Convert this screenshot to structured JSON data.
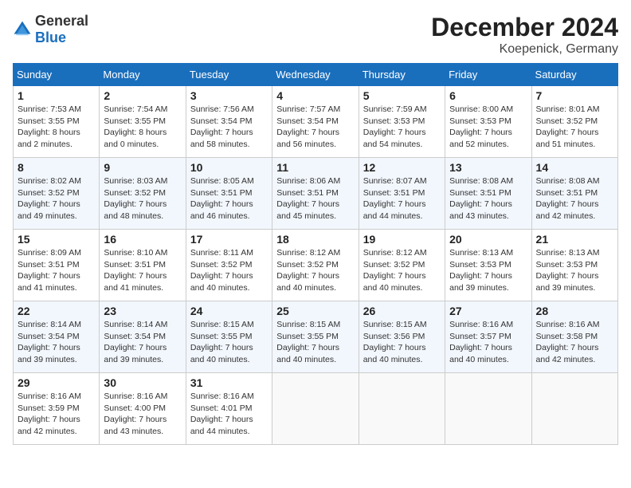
{
  "header": {
    "logo_general": "General",
    "logo_blue": "Blue",
    "month_title": "December 2024",
    "location": "Koepenick, Germany"
  },
  "weekdays": [
    "Sunday",
    "Monday",
    "Tuesday",
    "Wednesday",
    "Thursday",
    "Friday",
    "Saturday"
  ],
  "weeks": [
    [
      {
        "day": "1",
        "sunrise": "Sunrise: 7:53 AM",
        "sunset": "Sunset: 3:55 PM",
        "daylight": "Daylight: 8 hours and 2 minutes."
      },
      {
        "day": "2",
        "sunrise": "Sunrise: 7:54 AM",
        "sunset": "Sunset: 3:55 PM",
        "daylight": "Daylight: 8 hours and 0 minutes."
      },
      {
        "day": "3",
        "sunrise": "Sunrise: 7:56 AM",
        "sunset": "Sunset: 3:54 PM",
        "daylight": "Daylight: 7 hours and 58 minutes."
      },
      {
        "day": "4",
        "sunrise": "Sunrise: 7:57 AM",
        "sunset": "Sunset: 3:54 PM",
        "daylight": "Daylight: 7 hours and 56 minutes."
      },
      {
        "day": "5",
        "sunrise": "Sunrise: 7:59 AM",
        "sunset": "Sunset: 3:53 PM",
        "daylight": "Daylight: 7 hours and 54 minutes."
      },
      {
        "day": "6",
        "sunrise": "Sunrise: 8:00 AM",
        "sunset": "Sunset: 3:53 PM",
        "daylight": "Daylight: 7 hours and 52 minutes."
      },
      {
        "day": "7",
        "sunrise": "Sunrise: 8:01 AM",
        "sunset": "Sunset: 3:52 PM",
        "daylight": "Daylight: 7 hours and 51 minutes."
      }
    ],
    [
      {
        "day": "8",
        "sunrise": "Sunrise: 8:02 AM",
        "sunset": "Sunset: 3:52 PM",
        "daylight": "Daylight: 7 hours and 49 minutes."
      },
      {
        "day": "9",
        "sunrise": "Sunrise: 8:03 AM",
        "sunset": "Sunset: 3:52 PM",
        "daylight": "Daylight: 7 hours and 48 minutes."
      },
      {
        "day": "10",
        "sunrise": "Sunrise: 8:05 AM",
        "sunset": "Sunset: 3:51 PM",
        "daylight": "Daylight: 7 hours and 46 minutes."
      },
      {
        "day": "11",
        "sunrise": "Sunrise: 8:06 AM",
        "sunset": "Sunset: 3:51 PM",
        "daylight": "Daylight: 7 hours and 45 minutes."
      },
      {
        "day": "12",
        "sunrise": "Sunrise: 8:07 AM",
        "sunset": "Sunset: 3:51 PM",
        "daylight": "Daylight: 7 hours and 44 minutes."
      },
      {
        "day": "13",
        "sunrise": "Sunrise: 8:08 AM",
        "sunset": "Sunset: 3:51 PM",
        "daylight": "Daylight: 7 hours and 43 minutes."
      },
      {
        "day": "14",
        "sunrise": "Sunrise: 8:08 AM",
        "sunset": "Sunset: 3:51 PM",
        "daylight": "Daylight: 7 hours and 42 minutes."
      }
    ],
    [
      {
        "day": "15",
        "sunrise": "Sunrise: 8:09 AM",
        "sunset": "Sunset: 3:51 PM",
        "daylight": "Daylight: 7 hours and 41 minutes."
      },
      {
        "day": "16",
        "sunrise": "Sunrise: 8:10 AM",
        "sunset": "Sunset: 3:51 PM",
        "daylight": "Daylight: 7 hours and 41 minutes."
      },
      {
        "day": "17",
        "sunrise": "Sunrise: 8:11 AM",
        "sunset": "Sunset: 3:52 PM",
        "daylight": "Daylight: 7 hours and 40 minutes."
      },
      {
        "day": "18",
        "sunrise": "Sunrise: 8:12 AM",
        "sunset": "Sunset: 3:52 PM",
        "daylight": "Daylight: 7 hours and 40 minutes."
      },
      {
        "day": "19",
        "sunrise": "Sunrise: 8:12 AM",
        "sunset": "Sunset: 3:52 PM",
        "daylight": "Daylight: 7 hours and 40 minutes."
      },
      {
        "day": "20",
        "sunrise": "Sunrise: 8:13 AM",
        "sunset": "Sunset: 3:53 PM",
        "daylight": "Daylight: 7 hours and 39 minutes."
      },
      {
        "day": "21",
        "sunrise": "Sunrise: 8:13 AM",
        "sunset": "Sunset: 3:53 PM",
        "daylight": "Daylight: 7 hours and 39 minutes."
      }
    ],
    [
      {
        "day": "22",
        "sunrise": "Sunrise: 8:14 AM",
        "sunset": "Sunset: 3:54 PM",
        "daylight": "Daylight: 7 hours and 39 minutes."
      },
      {
        "day": "23",
        "sunrise": "Sunrise: 8:14 AM",
        "sunset": "Sunset: 3:54 PM",
        "daylight": "Daylight: 7 hours and 39 minutes."
      },
      {
        "day": "24",
        "sunrise": "Sunrise: 8:15 AM",
        "sunset": "Sunset: 3:55 PM",
        "daylight": "Daylight: 7 hours and 40 minutes."
      },
      {
        "day": "25",
        "sunrise": "Sunrise: 8:15 AM",
        "sunset": "Sunset: 3:55 PM",
        "daylight": "Daylight: 7 hours and 40 minutes."
      },
      {
        "day": "26",
        "sunrise": "Sunrise: 8:15 AM",
        "sunset": "Sunset: 3:56 PM",
        "daylight": "Daylight: 7 hours and 40 minutes."
      },
      {
        "day": "27",
        "sunrise": "Sunrise: 8:16 AM",
        "sunset": "Sunset: 3:57 PM",
        "daylight": "Daylight: 7 hours and 40 minutes."
      },
      {
        "day": "28",
        "sunrise": "Sunrise: 8:16 AM",
        "sunset": "Sunset: 3:58 PM",
        "daylight": "Daylight: 7 hours and 42 minutes."
      }
    ],
    [
      {
        "day": "29",
        "sunrise": "Sunrise: 8:16 AM",
        "sunset": "Sunset: 3:59 PM",
        "daylight": "Daylight: 7 hours and 42 minutes."
      },
      {
        "day": "30",
        "sunrise": "Sunrise: 8:16 AM",
        "sunset": "Sunset: 4:00 PM",
        "daylight": "Daylight: 7 hours and 43 minutes."
      },
      {
        "day": "31",
        "sunrise": "Sunrise: 8:16 AM",
        "sunset": "Sunset: 4:01 PM",
        "daylight": "Daylight: 7 hours and 44 minutes."
      },
      null,
      null,
      null,
      null
    ]
  ]
}
